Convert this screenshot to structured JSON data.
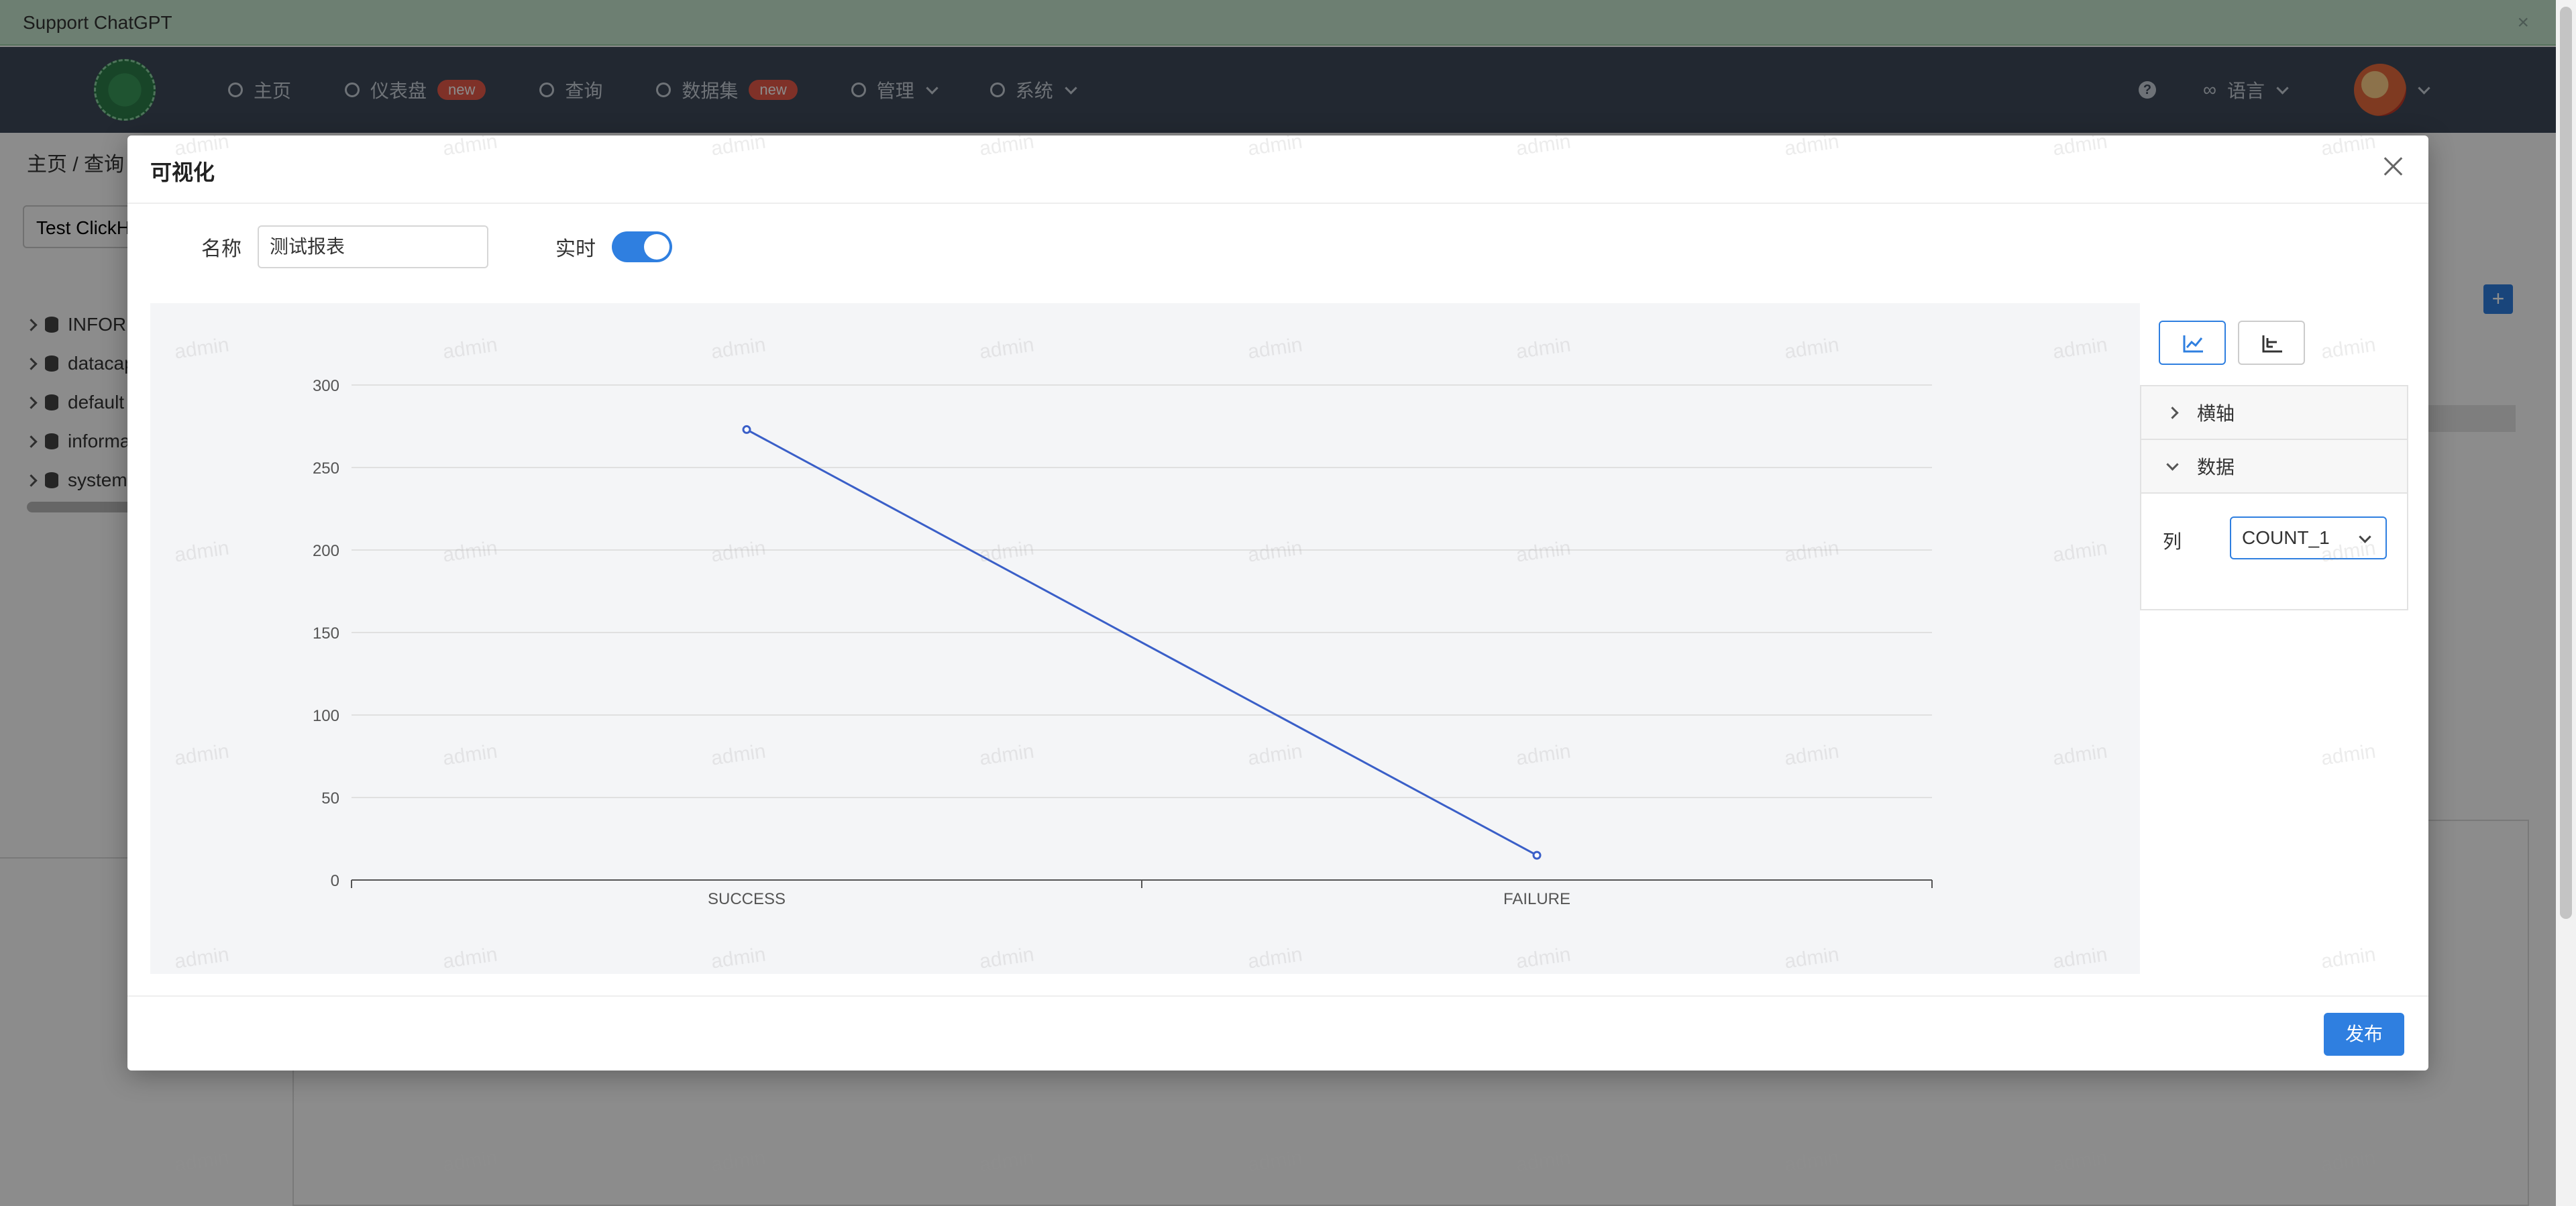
{
  "banner": {
    "text": "Support ChatGPT",
    "close": "×"
  },
  "header": {
    "nav": [
      {
        "label": "主页",
        "badge": ""
      },
      {
        "label": "仪表盘",
        "badge": "new"
      },
      {
        "label": "查询",
        "badge": ""
      },
      {
        "label": "数据集",
        "badge": "new"
      },
      {
        "label": "管理",
        "badge": ""
      },
      {
        "label": "系统",
        "badge": ""
      }
    ],
    "help": "?",
    "language": "语言"
  },
  "background": {
    "breadcrumb": "主页 / 查询",
    "datasource": "Test ClickH",
    "tree": [
      "INFORI",
      "datacap",
      "default",
      "informa",
      "system"
    ],
    "plus": "+"
  },
  "modal": {
    "title": "可视化",
    "name_label": "名称",
    "name_value": "测试报表",
    "realtime_label": "实时",
    "realtime_on": true,
    "panel": {
      "xaxis_label": "横轴",
      "data_label": "数据",
      "column_label": "列",
      "column_value": "COUNT_1"
    },
    "publish": "发布"
  },
  "watermark": "admin",
  "colors": {
    "accent": "#2f7fe0",
    "line": "#3a5fc8",
    "header": "#3e4a5a"
  },
  "chart_data": {
    "type": "line",
    "categories": [
      "SUCCESS",
      "FAILURE"
    ],
    "series": [
      {
        "values": [
          273,
          15
        ]
      }
    ],
    "ylim": [
      0,
      300
    ],
    "yticks": [
      0,
      50,
      100,
      150,
      200,
      250,
      300
    ],
    "grid": true
  }
}
